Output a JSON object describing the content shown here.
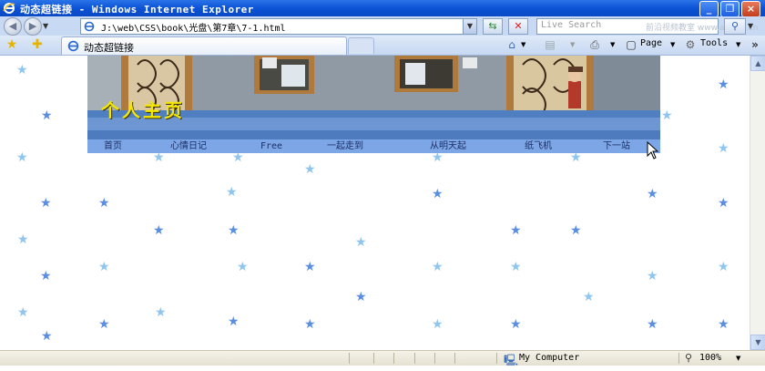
{
  "window": {
    "title": "动态超链接 - Windows Internet Explorer",
    "minimize": "_",
    "maximize": "❐",
    "close": "×"
  },
  "address_bar": {
    "url": "J:\\web\\CSS\\book\\光盘\\第7章\\7-1.html",
    "search_placeholder": "Live Search",
    "watermark": "前沿视频教室 www.artech.cn"
  },
  "tabs": [
    {
      "label": "动态超链接"
    }
  ],
  "command_bar": {
    "page_label": "Page",
    "tools_label": "Tools"
  },
  "page": {
    "banner_title": "个人主页",
    "nav_items": [
      {
        "label": "首页"
      },
      {
        "label": "心情日记"
      },
      {
        "label": "Free"
      },
      {
        "label": "一起走到"
      },
      {
        "label": "从明天起"
      },
      {
        "label": "纸飞机"
      },
      {
        "label": "下一站"
      }
    ],
    "star_colors": [
      "#5b8de0",
      "#8fc5ee"
    ]
  },
  "status_bar": {
    "zone": "My Computer",
    "zoom": "100%"
  }
}
